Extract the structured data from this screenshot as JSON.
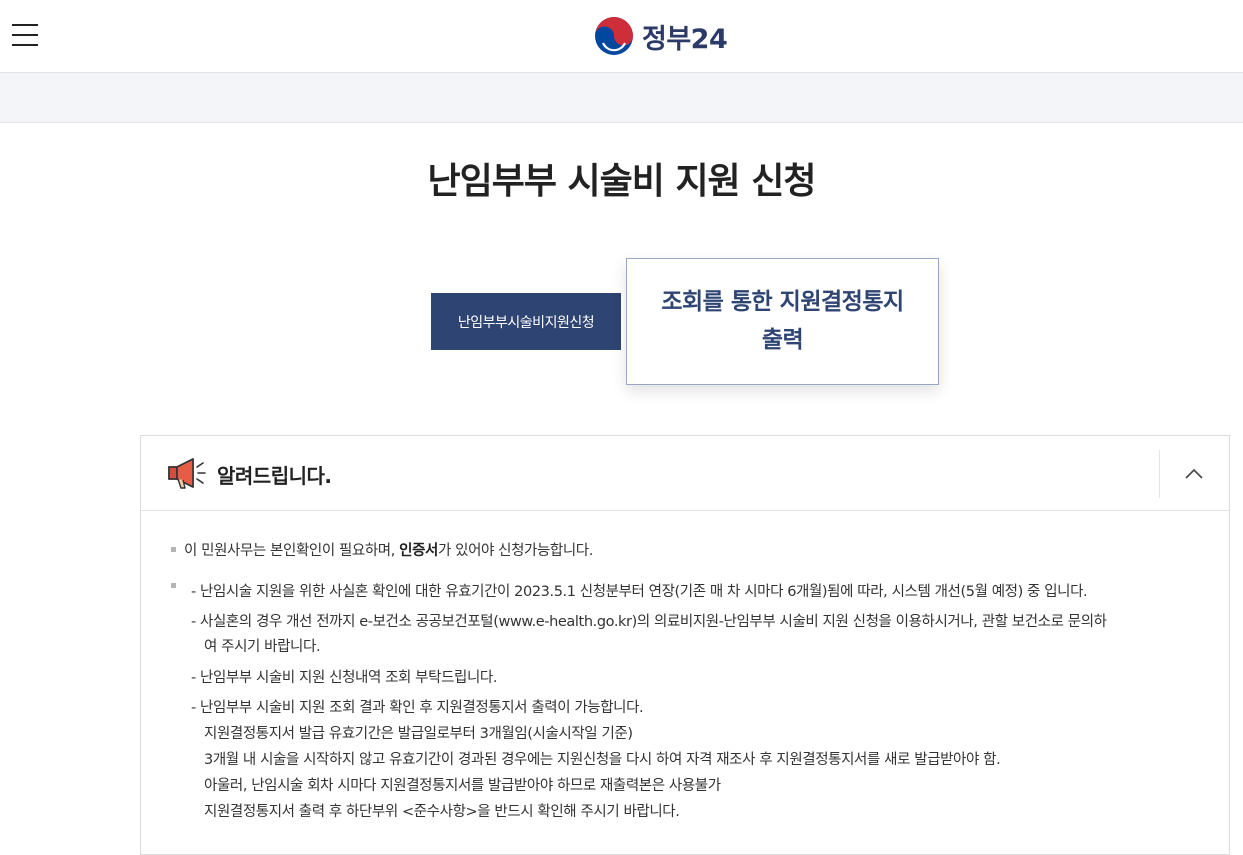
{
  "header": {
    "logo_text": "정부24"
  },
  "page": {
    "title": "난임부부 시술비 지원 신청"
  },
  "tabs": {
    "primary_label": "난임부부시술비지원신청",
    "secondary_line1": "조회를 통한 지원결정통지",
    "secondary_line2": "출력"
  },
  "notice": {
    "title": "알려드립니다.",
    "item1_pre": "이 민원사무는 본인확인이 필요하며, ",
    "item1_strong": "인증서",
    "item1_post": "가 있어야 신청가능합니다.",
    "dash1": "- 난임시술 지원을 위한 사실혼 확인에 대한 유효기간이 2023.5.1 신청분부터 연장(기존 매 차 시마다 6개월)됨에 따라, 시스템 개선(5월 예정) 중 입니다.",
    "dash2_line1": "- 사실혼의 경우 개선 전까지 e-보건소 공공보건포털(www.e-health.go.kr)의 의료비지원-난임부부 시술비 지원 신청을 이용하시거나, 관할 보건소로 문의하",
    "dash2_line2": "여 주시기 바랍니다.",
    "dash3": "- 난임부부 시술비 지원 신청내역 조회 부탁드립니다.",
    "dash4": "- 난임부부 시술비 지원 조회 결과 확인 후 지원결정통지서 출력이 가능합니다.",
    "cont1": "지원결정통지서 발급 유효기간은 발급일로부터 3개월임(시술시작일 기준)",
    "cont2": "3개월 내 시술을 시작하지 않고 유효기간이 경과된 경우에는 지원신청을 다시 하여 자격 재조사 후 지원결정통지서를 새로 발급받아야 함.",
    "cont3": "아울러, 난임시술 회차 시마다 지원결정통지서를 발급받아야 하므로 재출력본은 사용불가",
    "cont4": "지원결정통지서 출력 후 하단부위 <준수사항>을 반드시 확인해 주시기 바랍니다."
  },
  "colors": {
    "brand_navy": "#2e4473",
    "logo_red": "#cd2e3a",
    "logo_blue": "#0047a0"
  }
}
